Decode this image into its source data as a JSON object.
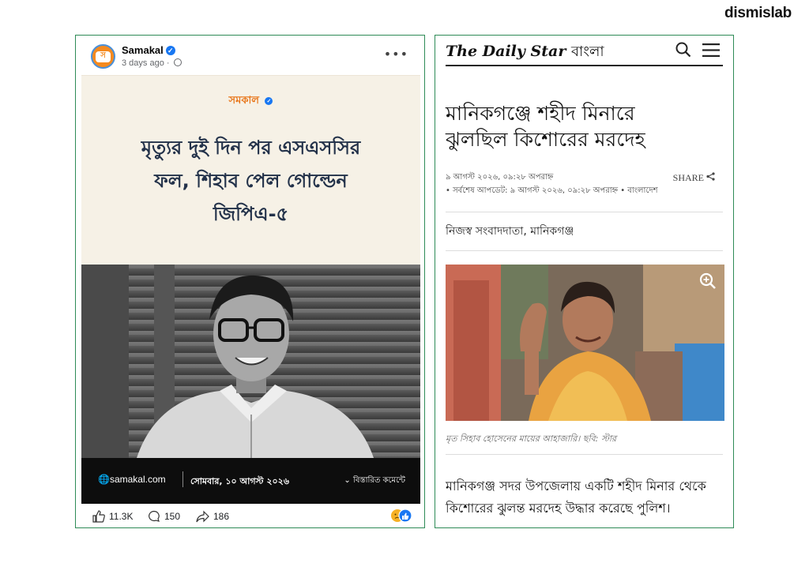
{
  "brand": "dismislab",
  "facebook_post": {
    "page_name": "Samakal",
    "time": "3 days ago",
    "card": {
      "logo": "সমকাল",
      "headline_lines": [
        "মৃত্যুর দুই দিন পর এসএসসির",
        "ফল, শিহাব পেল গোল্ডেন",
        "জিপিএ-৫"
      ],
      "site": "samakal.com",
      "date": "সোমবার, ১০ আগস্ট ২০২৬",
      "details": "বিস্তারিত কমেন্টে"
    },
    "actions": {
      "likes": "11.3K",
      "comments": "150",
      "shares": "186"
    },
    "colors": {
      "accent": "#f58a1f",
      "verified": "#1877f2",
      "headline": "#23324a"
    }
  },
  "daily_star": {
    "logo_en": "The Daily Star",
    "logo_bn": "বাংলা",
    "title_lines": [
      "মানিকগঞ্জে শহীদ মিনারে",
      "ঝুলছিল কিশোরের মরদেহ"
    ],
    "published": "৯ আগস্ট ২০২৬, ০৯:২৮ অপরাহ্ন",
    "updated": "• সর্বশেষ আপডেট: ৯ আগস্ট ২০২৬, ০৯:২৮ অপরাহ্ন • বাংলাদেশ",
    "share": "SHARE",
    "byline": "নিজস্ব সংবাদদাতা, মানিকগঞ্জ",
    "caption": "মৃত সিহাব হোসেনের মায়ের আহাজারি। ছবি: স্টার",
    "body_lines": [
      "মানিকগঞ্জ সদর উপজেলায় একটি শহীদ মিনার থেকে",
      "কিশোরের ঝুলন্ত মরদেহ উদ্ধার করেছে পুলিশ।"
    ]
  }
}
